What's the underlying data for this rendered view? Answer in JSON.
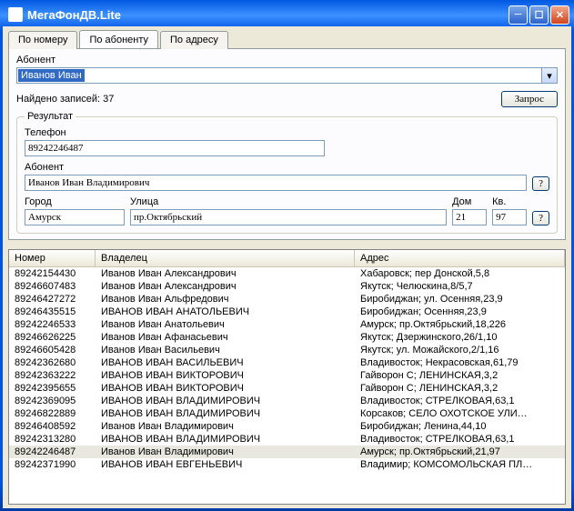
{
  "window": {
    "title": "МегаФонДВ.Lite"
  },
  "tabs": {
    "by_number": "По номеру",
    "by_subscriber": "По абоненту",
    "by_address": "По адресу"
  },
  "search": {
    "label": "Абонент",
    "value": "Иванов Иван"
  },
  "status": {
    "found_prefix": "Найдено записей: ",
    "count": "37",
    "query_btn": "Запрос"
  },
  "result": {
    "legend": "Результат",
    "phone_label": "Телефон",
    "phone_value": "89242246487",
    "subscriber_label": "Абонент",
    "subscriber_value": "Иванов Иван Владимирович",
    "city_label": "Город",
    "city_value": "Амурск",
    "street_label": "Улица",
    "street_value": "пр.Октябрьский",
    "house_label": "Дом",
    "house_value": "21",
    "apt_label": "Кв.",
    "apt_value": "97",
    "help_btn": "?"
  },
  "grid": {
    "headers": {
      "number": "Номер",
      "owner": "Владелец",
      "address": "Адрес"
    },
    "rows": [
      {
        "num": "89242154430",
        "own": "Иванов Иван Александрович",
        "adr": "Хабаровск; пер Донской,5,8"
      },
      {
        "num": "89246607483",
        "own": "Иванов Иван Александрович",
        "adr": "Якутск; Челюскина,8/5,7"
      },
      {
        "num": "89246427272",
        "own": "Иванов Иван Альфредович",
        "adr": "Биробиджан; ул. Осенняя,23,9"
      },
      {
        "num": "89246435515",
        "own": "ИВАНОВ ИВАН АНАТОЛЬЕВИЧ",
        "adr": "Биробиджан; Осенняя,23,9"
      },
      {
        "num": "89242246533",
        "own": "Иванов Иван Анатольевич",
        "adr": "Амурск; пр.Октябрьский,18,226"
      },
      {
        "num": "89246626225",
        "own": "Иванов Иван Афанасьевич",
        "adr": "Якутск; Дзержинского,26/1,10"
      },
      {
        "num": "89246605428",
        "own": "Иванов Иван Васильевич",
        "adr": "Якутск; ул. Можайского,2/1,16"
      },
      {
        "num": "89242362680",
        "own": "ИВАНОВ ИВАН ВАСИЛЬЕВИЧ",
        "adr": "Владивосток; Некрасовская,61,79"
      },
      {
        "num": "89242363222",
        "own": "ИВАНОВ ИВАН ВИКТОРОВИЧ",
        "adr": "Гайворон С; ЛЕНИНСКАЯ,3,2"
      },
      {
        "num": "89242395655",
        "own": "ИВАНОВ ИВАН ВИКТОРОВИЧ",
        "adr": "Гайворон С; ЛЕНИНСКАЯ,3,2"
      },
      {
        "num": "89242369095",
        "own": "ИВАНОВ ИВАН ВЛАДИМИРОВИЧ",
        "adr": "Владивосток; СТРЕЛКОВАЯ,63,1"
      },
      {
        "num": "89246822889",
        "own": "ИВАНОВ ИВАН ВЛАДИМИРОВИЧ",
        "adr": "Корсаков; СЕЛО ОХОТСКОЕ УЛИ…"
      },
      {
        "num": "89246408592",
        "own": "Иванов Иван Владимирович",
        "adr": "Биробиджан; Ленина,44,10"
      },
      {
        "num": "89242313280",
        "own": "ИВАНОВ ИВАН ВЛАДИМИРОВИЧ",
        "adr": "Владивосток; СТРЕЛКОВАЯ,63,1"
      },
      {
        "num": "89242246487",
        "own": "Иванов Иван Владимирович",
        "adr": "Амурск; пр.Октябрьский,21,97",
        "sel": true
      },
      {
        "num": "89242371990",
        "own": "ИВАНОВ ИВАН ЕВГЕНЬЕВИЧ",
        "adr": "Владимир; КОМСОМОЛЬСКАЯ ПЛ…"
      }
    ]
  }
}
